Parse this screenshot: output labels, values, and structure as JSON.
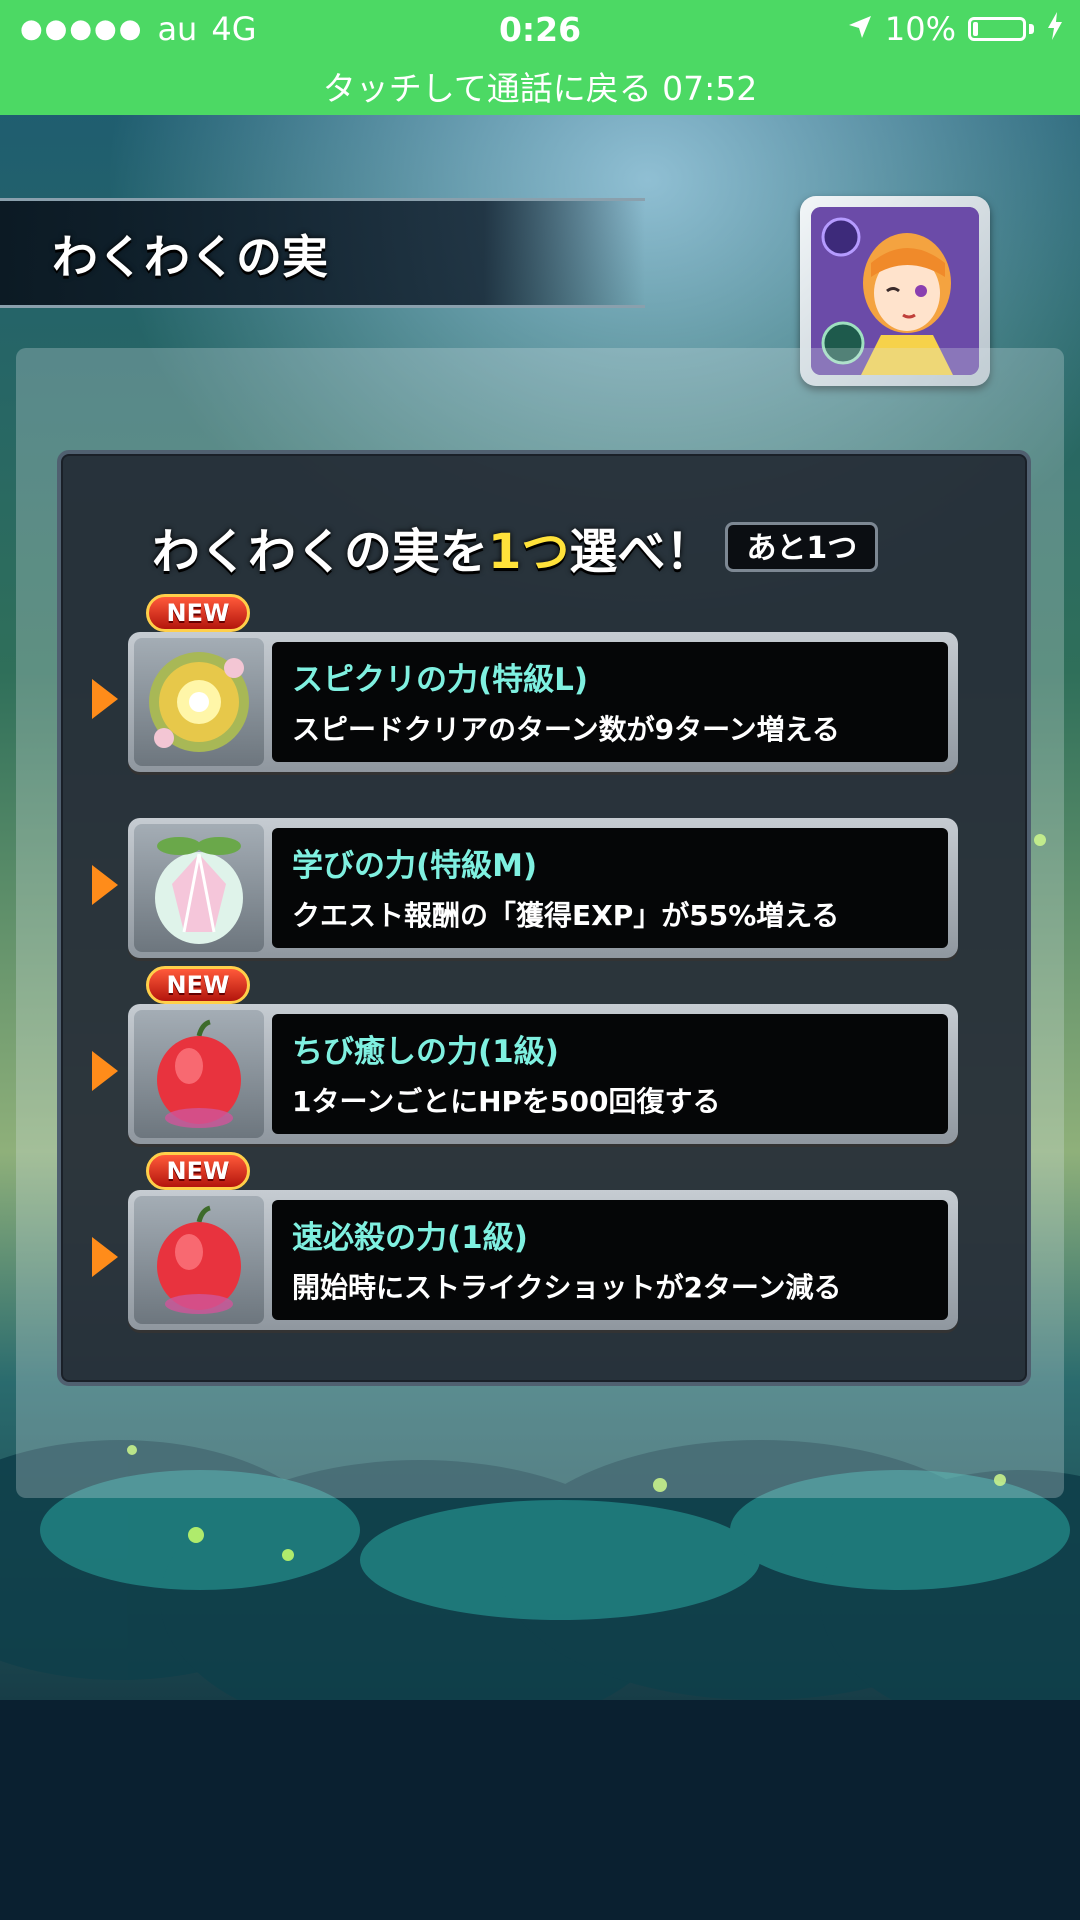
{
  "status_bar": {
    "carrier": "au",
    "network": "4G",
    "time": "0:26",
    "battery_percent": "10%",
    "battery_level": 0.1,
    "call_banner": "タッチして通話に戻る 07:52"
  },
  "screen": {
    "title": "わくわくの実"
  },
  "panel": {
    "heading_prefix": "わくわくの実を",
    "heading_highlight": "1つ",
    "heading_suffix": "選べ！",
    "remaining": "あと1つ"
  },
  "options": [
    {
      "new_badge": "NEW",
      "name": "スピクリの力(特級L)",
      "description": "スピードクリアのターン数が9ターン増える",
      "icon": "golden-orb-fruit-icon"
    },
    {
      "new_badge": "",
      "name": "学びの力(特級M)",
      "description": "クエスト報酬の「獲得EXP」が55%増える",
      "icon": "crystal-fruit-icon"
    },
    {
      "new_badge": "NEW",
      "name": "ちび癒しの力(1級)",
      "description": "1ターンごとにHPを500回復する",
      "icon": "red-fruit-icon"
    },
    {
      "new_badge": "NEW",
      "name": "速必殺の力(1級)",
      "description": "開始時にストライクショットが2ターン減る",
      "icon": "red-fruit-icon"
    }
  ],
  "colors": {
    "status_bar": "#4cd964",
    "option_name": "#7ff0e0",
    "highlight": "#ffe23a",
    "arrow": "#ff8c1a"
  }
}
